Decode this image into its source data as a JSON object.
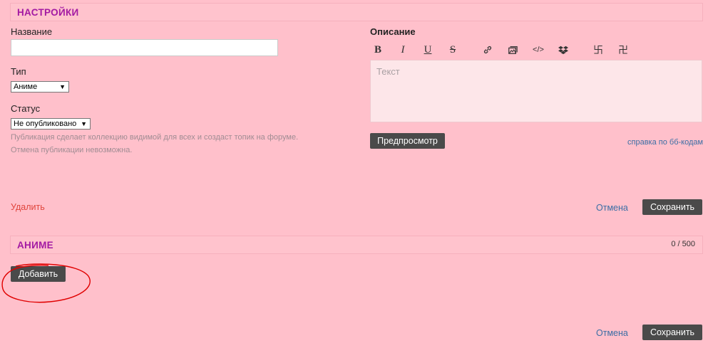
{
  "settings": {
    "header": "НАСТРОЙКИ",
    "name_label": "Название",
    "name_value": "",
    "type_label": "Тип",
    "type_value": "Аниме",
    "status_label": "Статус",
    "status_value": "Не опубликовано",
    "hint_line1": "Публикация сделает коллекцию видимой для всех и создаст топик на форуме.",
    "hint_line2": "Отмена публикации невозможна."
  },
  "description": {
    "label": "Описание",
    "toolbar": [
      {
        "icon": "bold-icon",
        "glyph": "B"
      },
      {
        "icon": "italic-icon",
        "glyph": "I"
      },
      {
        "icon": "underline-icon",
        "glyph": "U"
      },
      {
        "icon": "strikethrough-icon",
        "glyph": "S"
      },
      {
        "icon": "link-icon"
      },
      {
        "icon": "image-icon"
      },
      {
        "icon": "code-icon",
        "glyph": "</>"
      },
      {
        "icon": "dropbox-icon"
      },
      {
        "icon": "spoiler-left-icon",
        "glyph": "卐"
      },
      {
        "icon": "spoiler-right-icon",
        "glyph": "卍"
      }
    ],
    "placeholder": "Текст",
    "preview_button": "Предпросмотр",
    "bbcode_help": "справка по бб-кодам"
  },
  "actions": {
    "delete": "Удалить",
    "cancel": "Отмена",
    "save": "Сохранить"
  },
  "anime": {
    "header": "АНИМЕ",
    "counter": "0 / 500",
    "add_button": "Добавить",
    "cancel": "Отмена",
    "save": "Сохранить"
  },
  "colors": {
    "background": "#ffc0cb",
    "header_title": "#a31aa3",
    "dark_button": "#4a4a4a",
    "link": "#3b6ea5",
    "delete_link": "#e0453d",
    "annotation_circle": "#e00000"
  }
}
